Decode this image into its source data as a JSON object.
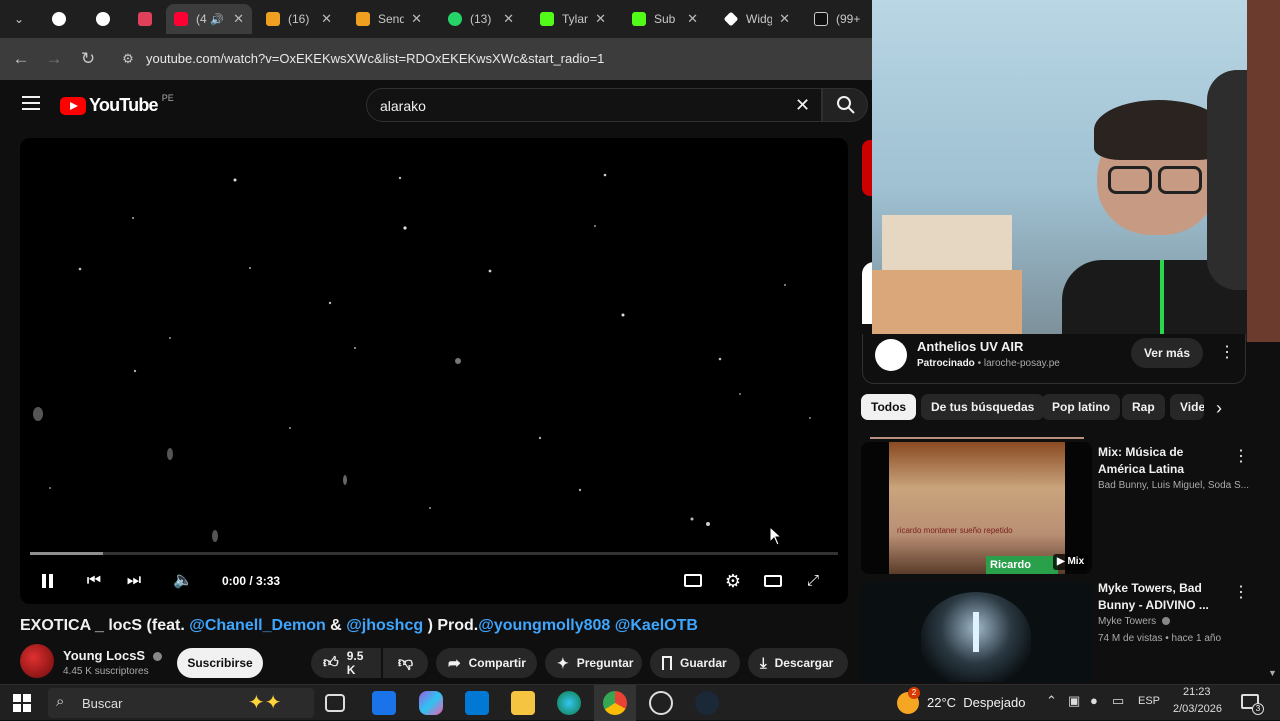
{
  "browser": {
    "tabs": [
      {
        "label": "",
        "icon": "chevron-down-icon"
      },
      {
        "label": "",
        "icon": "github-icon"
      },
      {
        "label": "",
        "icon": "github-icon"
      },
      {
        "label": "",
        "icon": "red-app-icon"
      },
      {
        "label": "(4",
        "icon": "youtube-icon",
        "audio": true,
        "active": true
      },
      {
        "label": "(16)",
        "icon": "orange-icon"
      },
      {
        "label": "Send",
        "icon": "orange-icon"
      },
      {
        "label": "(13)",
        "icon": "whatsapp-icon"
      },
      {
        "label": "Tylan",
        "icon": "kick-icon"
      },
      {
        "label": "Sub",
        "icon": "kick-icon"
      },
      {
        "label": "Widg",
        "icon": "widget-icon"
      },
      {
        "label": "(99+",
        "icon": "tiktok-icon"
      }
    ],
    "url": "youtube.com/watch?v=OxEKEKwsXWc&list=RDOxEKEKwsXWc&start_radio=1"
  },
  "youtube": {
    "logo_text": "YouTube",
    "country": "PE",
    "search_value": "alarako"
  },
  "player": {
    "time": "0:00 / 3:33",
    "progress_buffered": 0.09,
    "paused": false
  },
  "video": {
    "title_prefix": "EXOTICA _ locS (feat. ",
    "mention1": "@Chanell_Demon",
    "amp": " & ",
    "mention2": "@jhoshcg",
    "prod": " ) Prod.",
    "mention3": "@youngmolly808",
    "mention4": " @KaelOTB",
    "channel": "Young LocsS",
    "subscribers": "4.45 K suscriptores",
    "subscribe": "Suscribirse",
    "likes": "9.5 K",
    "share": "Compartir",
    "ask": "Preguntar",
    "save": "Guardar",
    "download": "Descargar"
  },
  "ad": {
    "title": "Anthelios UV AIR",
    "sponsored": "Patrocinado",
    "domain": "laroche-posay.pe",
    "cta": "Ver más"
  },
  "chips": [
    "Todos",
    "De tus búsquedas",
    "Pop latino",
    "Rap",
    "Vide"
  ],
  "recommendations": [
    {
      "title": "Mix: Música de América Latina",
      "subtitle": "Bad Bunny, Luis Miguel, Soda S...",
      "badge": "Mix",
      "thumb_text": "ricardo montaner sueño repetido",
      "thumb_brand": "Ricardo"
    },
    {
      "title": "Myke Towers, Bad Bunny - ADIVINO ...",
      "channel": "Myke Towers",
      "meta": "74 M de vistas • hace 1 año"
    }
  ],
  "taskbar": {
    "search": "Buscar",
    "weather_badge": "2",
    "weather": "22°C  Despejado",
    "lang": "ESP",
    "time": "21:23",
    "date": "2/03/2026",
    "notif": "3"
  }
}
